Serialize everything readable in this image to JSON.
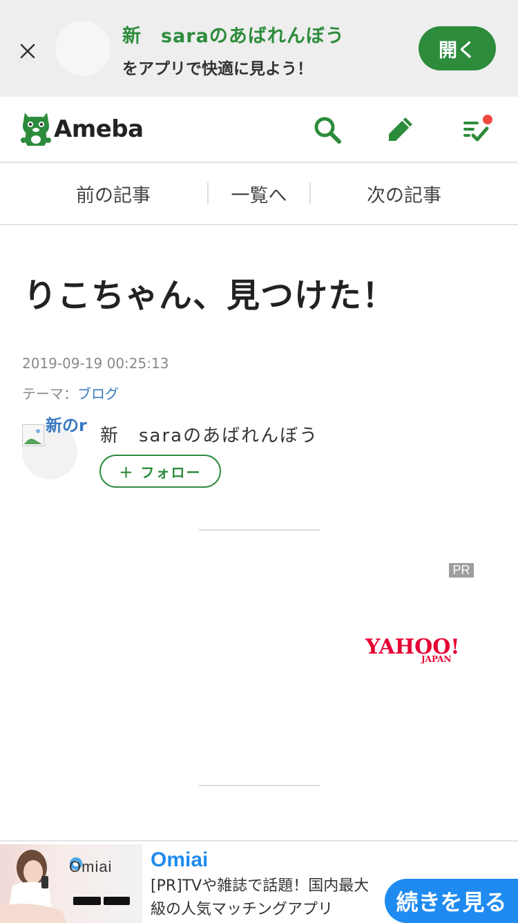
{
  "app_banner": {
    "blog_name": "新　saraのあばれんぼう",
    "subtitle": "をアプリで快適に見よう！",
    "open_label": "開く"
  },
  "header": {
    "logo_text": "Ameba"
  },
  "article_nav": {
    "prev_label": "前の記事",
    "list_label": "一覧へ",
    "next_label": "次の記事"
  },
  "article": {
    "title": "りこちゃん、見つけた！",
    "date": "2019-09-19 00:25:13",
    "theme_label": "テーマ：",
    "theme_value": "ブログ"
  },
  "author": {
    "avatar_alt": "新のr",
    "name": "新　saraのあばれんぼう",
    "follow_label": "＋ フォロー"
  },
  "ad": {
    "pr_label": "PR",
    "sponsor_logo_text": "YAHOO!",
    "sponsor_logo_sub": "JAPAN"
  },
  "bottom_ad": {
    "image_brand": "Omiai",
    "title": "Omiai",
    "description": "[PR]TVや雑誌で話題！国内最大級の人気マッチングアプリ",
    "cta_label": "続きを見る"
  },
  "colors": {
    "brand_green": "#2d8c3c",
    "link_blue": "#3a7ac1",
    "notification_red": "#f04a3e",
    "ad_blue": "#1f8bf0",
    "yahoo_red": "#e60033"
  }
}
